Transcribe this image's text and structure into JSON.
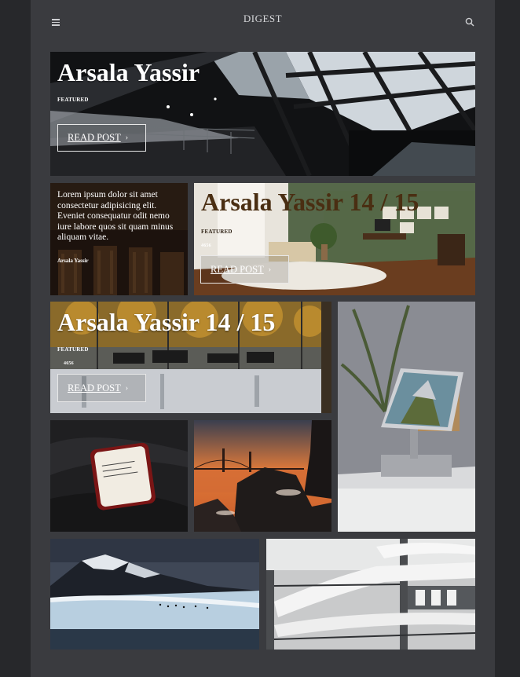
{
  "header": {
    "brand": "DIGEST",
    "menu_icon": "hamburger-menu-icon",
    "search_icon": "search-icon"
  },
  "posts": [
    {
      "title": "Arsala Yassir",
      "tag": "FEATURED",
      "button": "READ POST",
      "image": "glass-atrium-ceiling"
    },
    {
      "excerpt": "Lorem ipsum dolor sit amet consectetur adipisicing elit. Eveniet consequatur odit nemo iure labore quos sit quam minus aliquam vitae.",
      "author": "Arsala Yassir",
      "image": "cafe-wooden-chairs"
    },
    {
      "title": "Arsala Yassir 14 / 15",
      "tag": "FEATURED",
      "meta": "4656",
      "button": "READ POST",
      "image": "green-home-office"
    },
    {
      "title": "Arsala Yassir 14 / 15",
      "tag": "FEATURED",
      "meta": "4656",
      "button": "READ POST",
      "image": "food-court-hall"
    },
    {
      "image": "tablet-on-stand"
    },
    {
      "image": "phone-on-fabric"
    },
    {
      "image": "golden-gate-sunset"
    },
    {
      "image": "snowy-mountain-penguins"
    },
    {
      "image": "white-curved-architecture"
    }
  ],
  "colors": {
    "background": "#27282b",
    "panel": "#3a3b3f",
    "text": "#ffffff",
    "title_brown": "#4a2e12"
  }
}
